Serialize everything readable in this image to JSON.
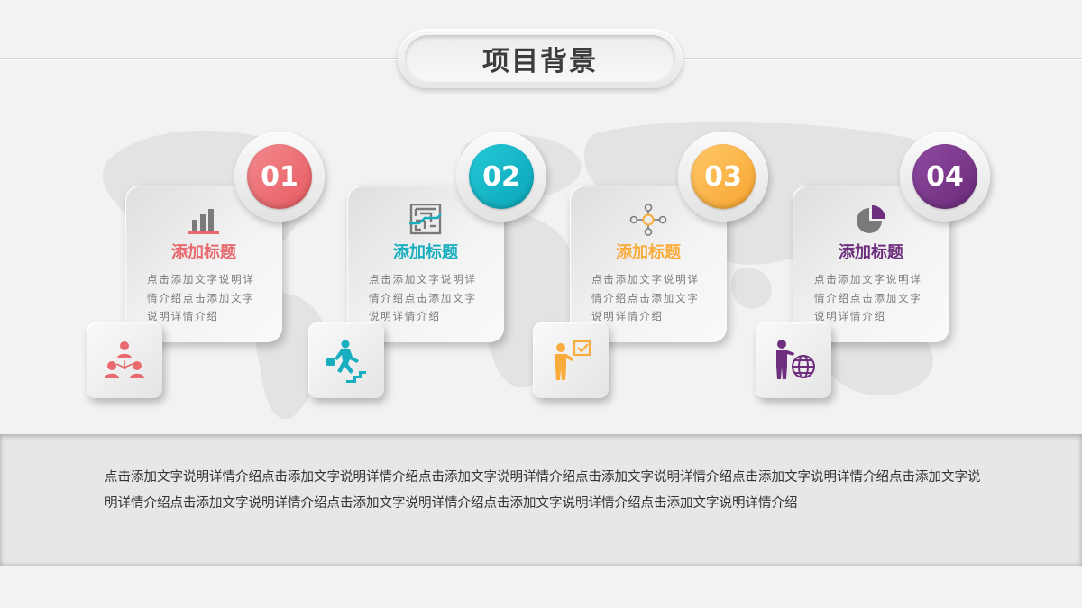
{
  "header": {
    "title": "项目背景"
  },
  "colors": {
    "red": "#e8696e",
    "teal": "#17aebf",
    "orange": "#f9ac3c",
    "purple": "#6e2f7e",
    "gray_icon": "#8a8a8a"
  },
  "cards": [
    {
      "number": "01",
      "title": "添加标题",
      "desc": "点击添加文字说明详情介绍点击添加文字说明详情介绍",
      "icon": "bar-chart-icon",
      "tile_icon": "team-hierarchy-icon",
      "color": "#e8696e"
    },
    {
      "number": "02",
      "title": "添加标题",
      "desc": "点击添加文字说明详情介绍点击添加文字说明详情介绍",
      "icon": "maze-icon",
      "tile_icon": "climbing-stairs-icon",
      "color": "#17aebf"
    },
    {
      "number": "03",
      "title": "添加标题",
      "desc": "点击添加文字说明详情介绍点击添加文字说明详情介绍",
      "icon": "network-nodes-icon",
      "tile_icon": "presenter-checklist-icon",
      "color": "#f9ac3c"
    },
    {
      "number": "04",
      "title": "添加标题",
      "desc": "点击添加文字说明详情介绍点击添加文字说明详情介绍",
      "icon": "pie-chart-icon",
      "tile_icon": "presenter-globe-icon",
      "color": "#6e2f7e"
    }
  ],
  "footer": {
    "text": "点击添加文字说明详情介绍点击添加文字说明详情介绍点击添加文字说明详情介绍点击添加文字说明详情介绍点击添加文字说明详情介绍点击添加文字说明详情介绍点击添加文字说明详情介绍点击添加文字说明详情介绍点击添加文字说明详情介绍点击添加文字说明详情介绍"
  }
}
